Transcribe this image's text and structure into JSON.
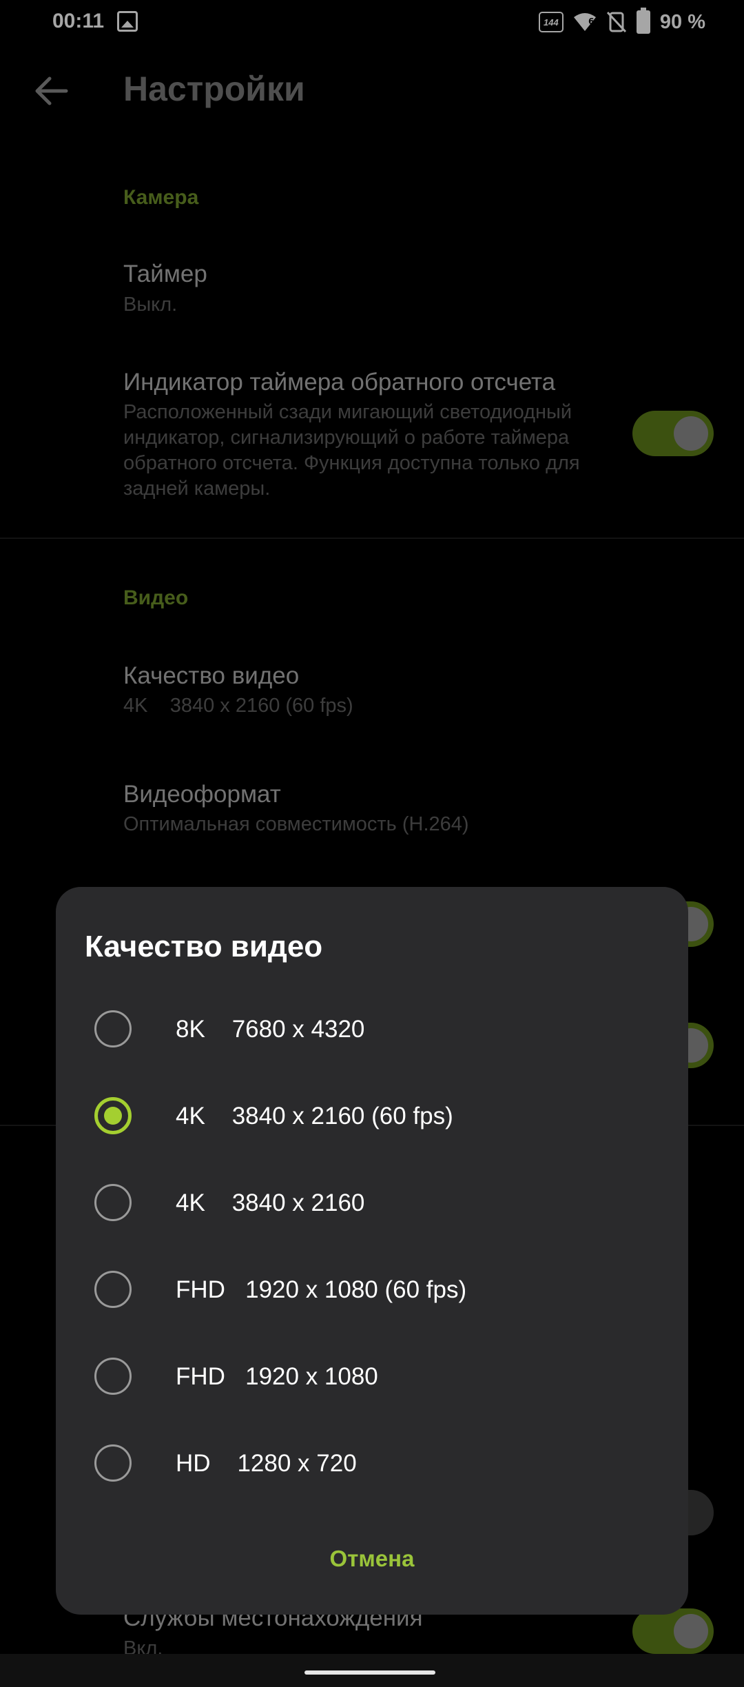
{
  "status_bar": {
    "time": "00:11",
    "refresh_rate": "144",
    "signal_label": "6",
    "battery_percent": "90 %"
  },
  "app_bar": {
    "title": "Настройки"
  },
  "settings": {
    "camera_header": "Камера",
    "timer_title": "Таймер",
    "timer_value": "Выкл.",
    "countdown_title": "Индикатор таймера обратного отсчета",
    "countdown_desc": "Расположенный сзади мигающий светодиодный индикатор, сигнализирующий о работе таймера обратного отсчета. Функция доступна только для задней камеры.",
    "video_header": "Видео",
    "video_quality_title": "Качество видео",
    "video_quality_value": "4K    3840 x 2160 (60 fps)",
    "video_format_title": "Видеоформат",
    "video_format_value": "Оптимальная совместимость (H.264)",
    "location_title": "Службы местонахождения",
    "location_value": "Вкл."
  },
  "dialog": {
    "title": "Качество видео",
    "options": [
      {
        "label": "8K    7680 x 4320",
        "checked": false
      },
      {
        "label": "4K    3840 x 2160 (60 fps)",
        "checked": true
      },
      {
        "label": "4K    3840 x 2160",
        "checked": false
      },
      {
        "label": "FHD   1920 x 1080 (60 fps)",
        "checked": false
      },
      {
        "label": "FHD   1920 x 1080",
        "checked": false
      },
      {
        "label": "HD    1280 x 720",
        "checked": false
      }
    ],
    "cancel_label": "Отмена"
  },
  "colors": {
    "accent": "#a4cf30",
    "dialog_bg": "#2a2a2c",
    "section_header": "#6e8f2a"
  }
}
